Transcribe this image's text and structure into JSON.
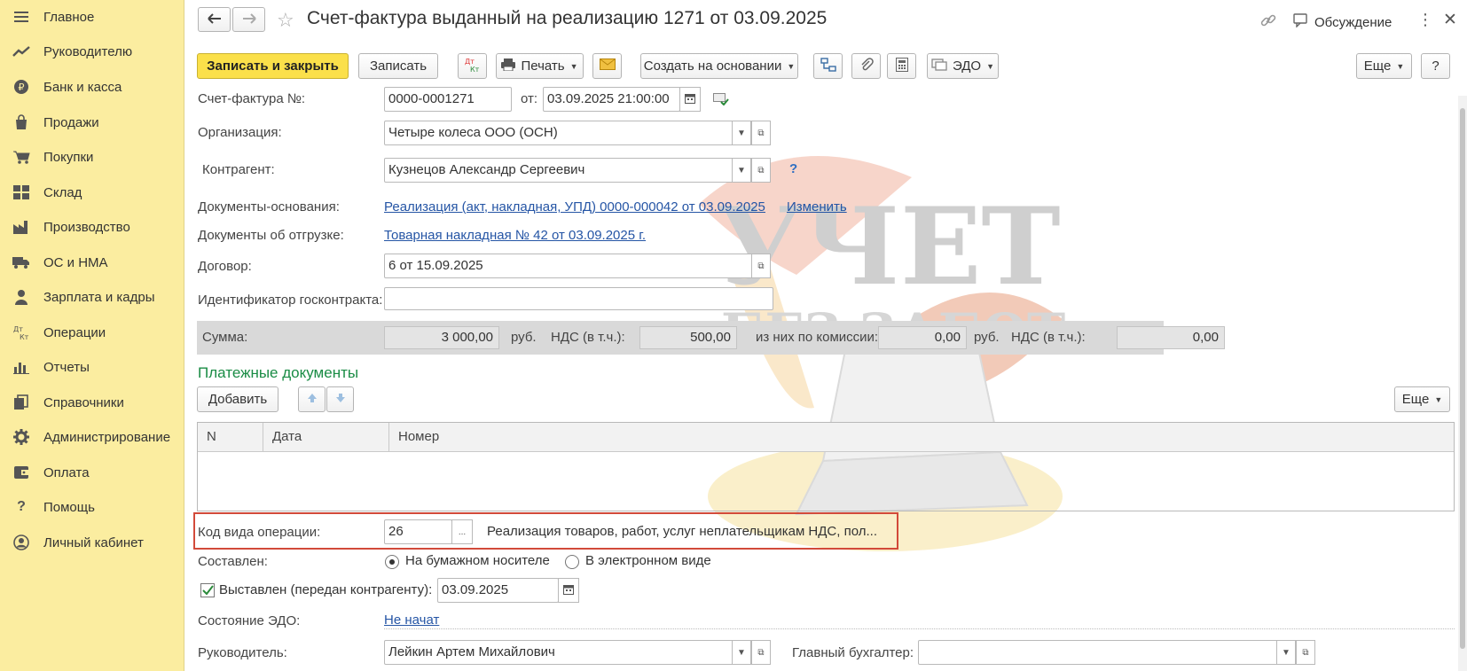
{
  "sidebar": {
    "items": [
      {
        "label": "Главное",
        "icon": "menu-icon"
      },
      {
        "label": "Руководителю",
        "icon": "chart-line-icon"
      },
      {
        "label": "Банк и касса",
        "icon": "ruble-icon"
      },
      {
        "label": "Продажи",
        "icon": "shopping-bag-icon"
      },
      {
        "label": "Покупки",
        "icon": "cart-icon"
      },
      {
        "label": "Склад",
        "icon": "grid-icon"
      },
      {
        "label": "Производство",
        "icon": "factory-icon"
      },
      {
        "label": "ОС и НМА",
        "icon": "truck-icon"
      },
      {
        "label": "Зарплата и кадры",
        "icon": "person-icon"
      },
      {
        "label": "Операции",
        "icon": "dt-kt-icon"
      },
      {
        "label": "Отчеты",
        "icon": "bar-chart-icon"
      },
      {
        "label": "Справочники",
        "icon": "books-icon"
      },
      {
        "label": "Администрирование",
        "icon": "gear-icon"
      },
      {
        "label": "Оплата",
        "icon": "wallet-icon"
      },
      {
        "label": "Помощь",
        "icon": "question-icon"
      },
      {
        "label": "Личный кабинет",
        "icon": "account-icon"
      }
    ]
  },
  "header": {
    "title": "Счет-фактура выданный на реализацию 1271 от 03.09.2025",
    "discussion": "Обсуждение"
  },
  "toolbar": {
    "save_close": "Записать и закрыть",
    "save": "Записать",
    "dtkt": "Дт/Кт",
    "print": "Печать",
    "create_based": "Создать на основании",
    "edo": "ЭДО",
    "more": "Еще",
    "help": "?"
  },
  "form": {
    "invoice_no_label": "Счет-фактура №:",
    "invoice_no": "0000-0001271",
    "from_label": "от:",
    "date": "03.09.2025 21:00:00",
    "org_label": "Организация:",
    "org": "Четыре колеса ООО (ОСН)",
    "counterparty_label": "Контрагент:",
    "counterparty": "Кузнецов Александр Сергеевич",
    "help_mark": "?",
    "base_docs_label": "Документы-основания:",
    "base_docs": "Реализация (акт, накладная, УПД) 0000-000042 от 03.09.2025 ...",
    "change": "Изменить",
    "ship_docs_label": "Документы об отгрузке:",
    "ship_docs": "Товарная накладная № 42 от 03.09.2025 г.",
    "contract_label": "Договор:",
    "contract": "6 от 15.09.2025",
    "gov_id_label": "Идентификатор госконтракта:",
    "gov_id": ""
  },
  "sums": {
    "sum_label": "Сумма:",
    "sum": "3 000,00",
    "rub1": "руб.",
    "vat_label": "НДС (в т.ч.):",
    "vat": "500,00",
    "commission_label": "из них по комиссии:",
    "commission": "0,00",
    "rub2": "руб.",
    "vat2_label": "НДС (в т.ч.):",
    "vat2": "0,00"
  },
  "payments": {
    "title": "Платежные документы",
    "add": "Добавить",
    "more": "Еще",
    "columns": [
      "N",
      "Дата",
      "Номер"
    ]
  },
  "operation": {
    "label": "Код вида операции:",
    "code": "26",
    "ellipsis": "...",
    "description": "Реализация товаров, работ, услуг неплательщикам НДС, пол..."
  },
  "compiled": {
    "label": "Составлен:",
    "paper": "На бумажном носителе",
    "electronic": "В электронном виде",
    "selected": "paper"
  },
  "issued": {
    "label": "Выставлен (передан контрагенту):",
    "checked": true,
    "date": "03.09.2025"
  },
  "edo_state": {
    "label": "Состояние ЭДО:",
    "value": "Не начат"
  },
  "signers": {
    "head_label": "Руководитель:",
    "head": "Лейкин Артем Михайлович",
    "accountant_label": "Главный бухгалтер:",
    "accountant": ""
  },
  "watermark": {
    "line1": "УЧЕТ",
    "line2": "БЕЗ ЗАБОТ"
  },
  "colors": {
    "sidebar_bg": "#fbeda0",
    "primary_button": "#fbe04a",
    "section_title": "#1a8c45",
    "link": "#2555a5",
    "highlight_border": "#d24a3a"
  }
}
